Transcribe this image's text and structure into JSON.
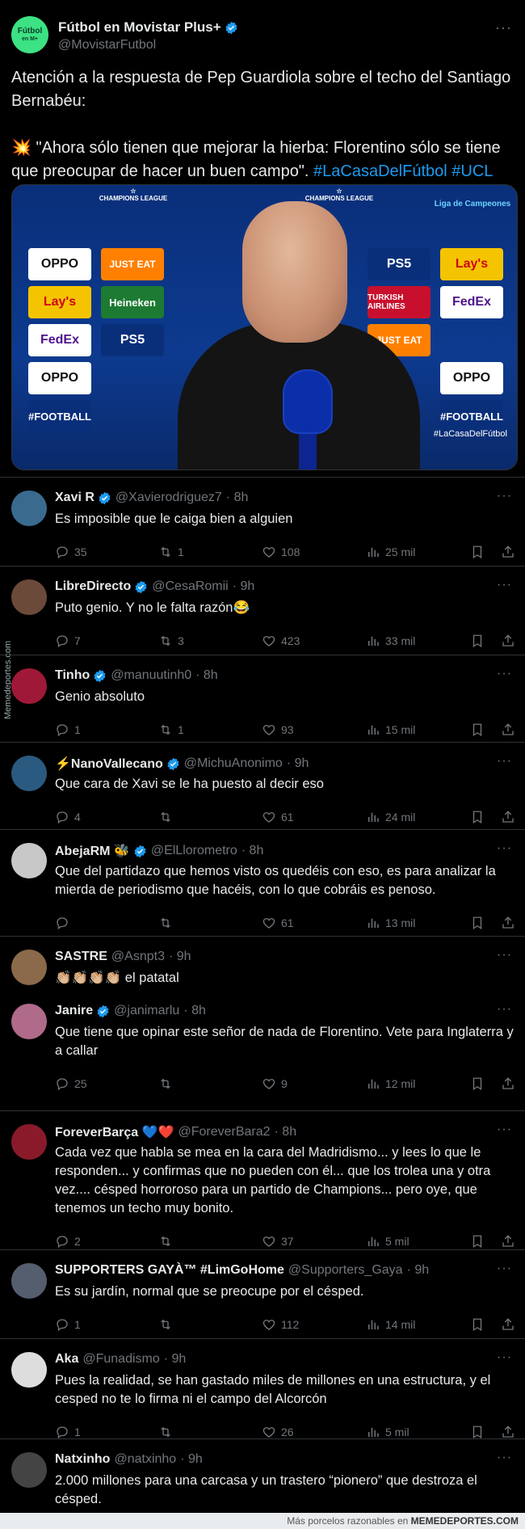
{
  "main": {
    "name": "Fútbol en Movistar Plus+",
    "handle": "@MovistarFutbol",
    "avatar_text": "Fútbol",
    "avatar_sub": "en M+",
    "text_line1": "Atención a la respuesta de Pep Guardiola sobre el techo del Santiago Bernabéu:",
    "text_line2": "\"Ahora sólo tienen que mejorar la hierba: Florentino sólo se tiene que preocupar de hacer un buen campo\".",
    "emoji": "💥",
    "hashtag1": "#LaCasaDelFútbol",
    "hashtag2": "#UCL",
    "media_tag": "#LaCasaDelFútbol",
    "media_ucl": "CHAMPIONS LEAGUE",
    "media_corner": "Liga de Campeones",
    "sponsors": [
      "OPPO",
      "JUST EAT",
      "Lay's",
      "Heineken",
      "FedEx",
      "PS5",
      "TURKISH AIRLINES",
      "#FOOTBALL"
    ]
  },
  "replies": [
    {
      "name": "Xavi R",
      "handle": "@Xavierodriguez7",
      "time": "· 8h",
      "text": "Es imposible que le caiga bien a alguien",
      "replies": "35",
      "retweets": "1",
      "likes": "108",
      "views": "25 mil"
    },
    {
      "name": "LibreDirecto",
      "handle": "@CesaRomii",
      "time": "· 9h",
      "text": "Puto genio. Y no le falta razón😂",
      "replies": "7",
      "retweets": "3",
      "likes": "423",
      "views": "33 mil"
    },
    {
      "name": "Tinho",
      "handle": "@manuutinh0",
      "time": "· 8h",
      "text": "Genio absoluto",
      "replies": "1",
      "retweets": "1",
      "likes": "93",
      "views": "15 mil"
    },
    {
      "name": "⚡NanoVallecano",
      "handle": "@MichuAnonimo",
      "time": "· 9h",
      "text": "Que cara de Xavi se le ha puesto al decir eso",
      "replies": "4",
      "retweets": "",
      "likes": "61",
      "views": "24 mil"
    },
    {
      "name": "AbejaRM 🐝",
      "handle": "@ElLlorometro",
      "time": "· 8h",
      "text": "Que del partidazo que hemos visto os quedéis con eso, es para analizar la mierda de periodismo que hacéis, con lo que cobráis es penoso.",
      "replies": "",
      "retweets": "",
      "likes": "61",
      "views": "13 mil"
    },
    {
      "name": "SASTRE",
      "handle": "@Asnpt3",
      "time": "· 9h",
      "text": "👏🏼👏🏼👏🏼👏🏼 el patatal"
    },
    {
      "name": "Janire",
      "handle": "@janimarlu",
      "time": "· 8h",
      "text": "Que tiene que opinar este señor de nada de Florentino. Vete para Inglaterra y a callar",
      "replies": "25",
      "retweets": "",
      "likes": "9",
      "views": "12 mil"
    },
    {
      "name": "ForeverBarça 💙❤️",
      "handle": "@ForeverBara2",
      "time": "· 8h",
      "text": "Cada vez que habla se mea en la cara del Madridismo... y lees lo que le responden... y confirmas que no pueden con él... que los trolea una y otra vez.... césped horroroso para un partido de Champions... pero oye, que tenemos un techo muy bonito.",
      "replies": "2",
      "retweets": "",
      "likes": "37",
      "views": "5 mil"
    },
    {
      "name": "SUPPORTERS GAYÀ™ #LimGoHome",
      "handle": "@Supporters_Gaya",
      "time": "· 9h",
      "text": "Es su jardín, normal que se preocupe por el césped.",
      "replies": "1",
      "retweets": "",
      "likes": "112",
      "views": "14 mil"
    },
    {
      "name": "Aka",
      "handle": "@Funadismo",
      "time": "· 9h",
      "text": "Pues la realidad, se han gastado miles de millones en una estructura, y el cesped no te lo firma ni el campo del Alcorcón",
      "replies": "1",
      "retweets": "",
      "likes": "26",
      "views": "5 mil"
    },
    {
      "name": "Natxinho",
      "handle": "@natxinho",
      "time": "· 9h",
      "text": "2.000 millones para una carcasa y un trastero “pionero” que destroza el césped."
    }
  ],
  "footer": {
    "text": "Más porcelos razonables en",
    "site": "MEMEDEPORTES.COM"
  },
  "side_watermark": "Memedeportes.com",
  "colors": {
    "accent": "#1d9bf0",
    "muted": "#71767b",
    "text": "#e7e9ea",
    "divider": "#2f3336"
  }
}
